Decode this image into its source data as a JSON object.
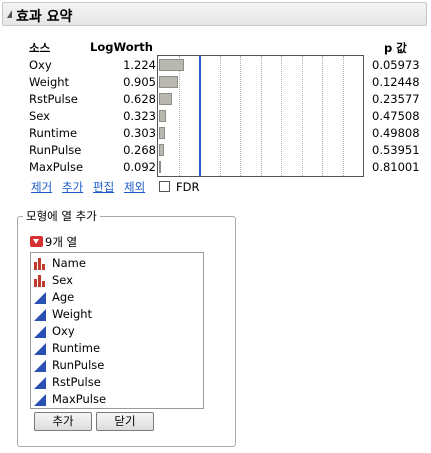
{
  "header": {
    "title": "효과 요약"
  },
  "table": {
    "col_source": "소스",
    "col_logworth": "LogWorth",
    "col_p": "p 값",
    "rows": [
      {
        "source": "Oxy",
        "logworth": "1.224",
        "p": "0.05973",
        "value": 1.224
      },
      {
        "source": "Weight",
        "logworth": "0.905",
        "p": "0.12448",
        "value": 0.905
      },
      {
        "source": "RstPulse",
        "logworth": "0.628",
        "p": "0.23577",
        "value": 0.628
      },
      {
        "source": "Sex",
        "logworth": "0.323",
        "p": "0.47508",
        "value": 0.323
      },
      {
        "source": "Runtime",
        "logworth": "0.303",
        "p": "0.49808",
        "value": 0.303
      },
      {
        "source": "RunPulse",
        "logworth": "0.268",
        "p": "0.53951",
        "value": 0.268
      },
      {
        "source": "MaxPulse",
        "logworth": "0.092",
        "p": "0.81001",
        "value": 0.092
      }
    ]
  },
  "chart_data": {
    "type": "bar",
    "categories": [
      "Oxy",
      "Weight",
      "RstPulse",
      "Sex",
      "Runtime",
      "RunPulse",
      "MaxPulse"
    ],
    "values": [
      1.224,
      0.905,
      0.628,
      0.323,
      0.303,
      0.268,
      0.092
    ],
    "xlim": [
      0,
      10
    ],
    "reference_line": 2,
    "gridlines": [
      1,
      2,
      3,
      4,
      5,
      6,
      7,
      8,
      9
    ],
    "colors": {
      "bar": "#b8b8b0",
      "reference_line": "#2c5bd0"
    }
  },
  "actions": {
    "remove": "제거",
    "add": "추가",
    "edit": "편집",
    "exclude": "제외",
    "fdr_label": "FDR",
    "fdr_checked": false
  },
  "add_panel": {
    "legend": "모형에 열 추가",
    "count_label": "9개 열",
    "columns": [
      {
        "name": "Name",
        "icon": "nominal-icon"
      },
      {
        "name": "Sex",
        "icon": "nominal-icon"
      },
      {
        "name": "Age",
        "icon": "continuous-icon"
      },
      {
        "name": "Weight",
        "icon": "continuous-icon"
      },
      {
        "name": "Oxy",
        "icon": "continuous-icon"
      },
      {
        "name": "Runtime",
        "icon": "continuous-icon"
      },
      {
        "name": "RunPulse",
        "icon": "continuous-icon"
      },
      {
        "name": "RstPulse",
        "icon": "continuous-icon"
      },
      {
        "name": "MaxPulse",
        "icon": "continuous-icon"
      }
    ],
    "add_button": "추가",
    "close_button": "닫기"
  },
  "colors": {
    "link": "#1a5cc8",
    "nominal_icon": "#c0392b",
    "continuous_icon": "#2a4fb5"
  }
}
